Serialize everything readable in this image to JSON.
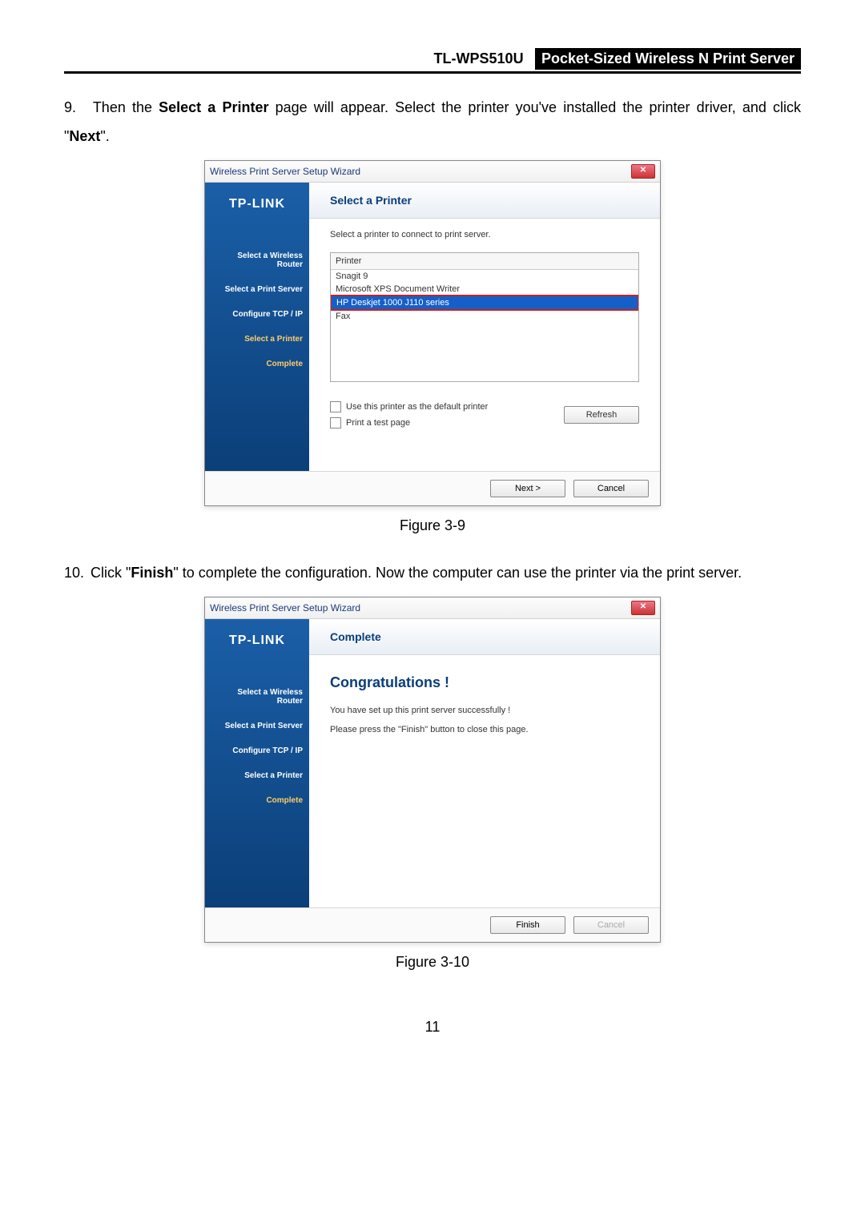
{
  "header": {
    "model": "TL-WPS510U",
    "description": "Pocket-Sized Wireless N Print Server"
  },
  "step9": {
    "number": "9.",
    "text_before_bold": "Then the ",
    "bold1": "Select a Printer",
    "text_mid": " page will appear. Select the printer you've installed the printer driver, and click \"",
    "bold2": "Next",
    "text_after": "\"."
  },
  "step10": {
    "number": "10.",
    "text_before_bold": "Click \"",
    "bold1": "Finish",
    "text_mid": "\" to complete the configuration. Now the computer can use the printer via the print server."
  },
  "figure9": "Figure 3-9",
  "figure10": "Figure 3-10",
  "page_number": "11",
  "wizard_common": {
    "title": "Wireless Print Server Setup Wizard",
    "close": "✕",
    "logo": "TP-LINK",
    "steps": {
      "s1": "Select a Wireless Router",
      "s2": "Select a Print Server",
      "s3": "Configure TCP / IP",
      "s4": "Select a Printer",
      "s5": "Complete"
    }
  },
  "wizard1": {
    "panel_title": "Select a Printer",
    "instruction": "Select a printer to connect to print server.",
    "list_header": "Printer",
    "printers": {
      "p0": "Snagit 9",
      "p1": "Microsoft XPS Document Writer",
      "p2": "HP Deskjet 1000 J110 series",
      "p3": "Fax"
    },
    "opt_default": "Use this printer as the default printer",
    "opt_testpage": "Print a test page",
    "btn_refresh": "Refresh",
    "btn_next": "Next >",
    "btn_cancel": "Cancel"
  },
  "wizard2": {
    "panel_title": "Complete",
    "congrats": "Congratulations !",
    "line1": "You have set up this print server successfully !",
    "line2": "Please press the \"Finish\" button to close this page.",
    "btn_finish": "Finish",
    "btn_cancel": "Cancel"
  }
}
